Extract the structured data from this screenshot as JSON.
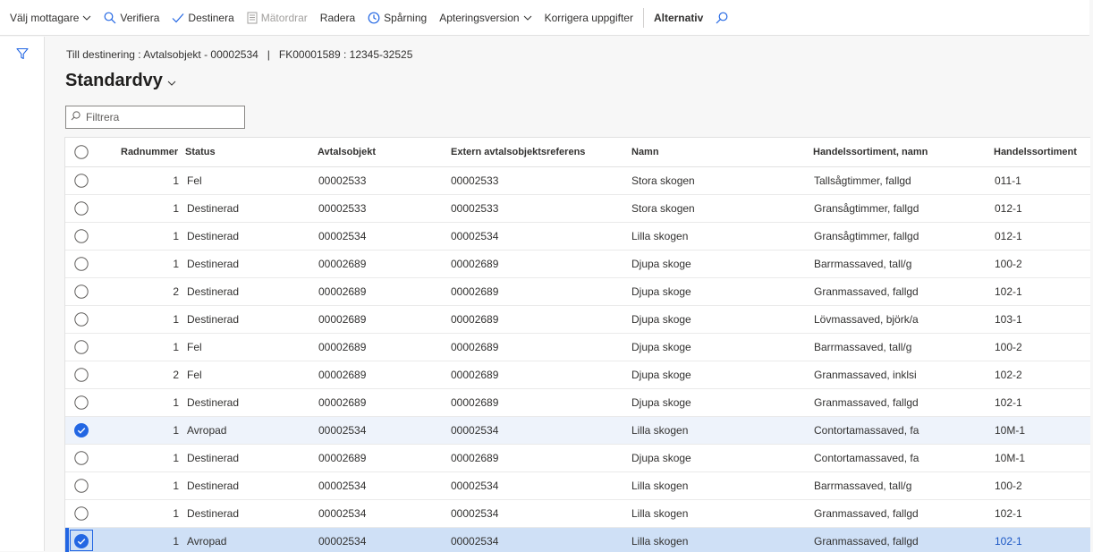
{
  "action_pane": {
    "valj_mottagare": "Välj mottagare",
    "verifiera": "Verifiera",
    "destinera": "Destinera",
    "matordrar": "Mätordrar",
    "radera": "Radera",
    "sparning": "Spårning",
    "apteringsversion": "Apteringsversion",
    "korrigera": "Korrigera uppgifter",
    "alternativ": "Alternativ"
  },
  "breadcrumb": "Till destinering : Avtalsobjekt - 00002534   |   FK00001589 : 12345-32525",
  "view_title": "Standardvy",
  "filter": {
    "placeholder": "Filtrera",
    "value": ""
  },
  "columns": {
    "radnummer": "Radnummer",
    "status": "Status",
    "avtalsobjekt": "Avtalsobjekt",
    "extern": "Extern avtalsobjektsreferens",
    "namn": "Namn",
    "handels_namn": "Handelssortiment, namn",
    "handels": "Handelssortiment"
  },
  "rows": [
    {
      "rad": "1",
      "status": "Fel",
      "avtal": "00002533",
      "extern": "00002533",
      "namn": "Stora skogen",
      "hnamn": "Tallsågtimmer, fallgd",
      "h": "011-1",
      "checked": false,
      "active": false
    },
    {
      "rad": "1",
      "status": "Destinerad",
      "avtal": "00002533",
      "extern": "00002533",
      "namn": "Stora skogen",
      "hnamn": "Gransågtimmer, fallgd",
      "h": "012-1",
      "checked": false,
      "active": false
    },
    {
      "rad": "1",
      "status": "Destinerad",
      "avtal": "00002534",
      "extern": "00002534",
      "namn": "Lilla skogen",
      "hnamn": "Gransågtimmer, fallgd",
      "h": "012-1",
      "checked": false,
      "active": false
    },
    {
      "rad": "1",
      "status": "Destinerad",
      "avtal": "00002689",
      "extern": "00002689",
      "namn": "Djupa skoge",
      "hnamn": "Barrmassaved, tall/g",
      "h": "100-2",
      "checked": false,
      "active": false
    },
    {
      "rad": "2",
      "status": "Destinerad",
      "avtal": "00002689",
      "extern": "00002689",
      "namn": "Djupa skoge",
      "hnamn": "Granmassaved, fallgd",
      "h": "102-1",
      "checked": false,
      "active": false
    },
    {
      "rad": "1",
      "status": "Destinerad",
      "avtal": "00002689",
      "extern": "00002689",
      "namn": "Djupa skoge",
      "hnamn": "Lövmassaved, björk/a",
      "h": "103-1",
      "checked": false,
      "active": false
    },
    {
      "rad": "1",
      "status": "Fel",
      "avtal": "00002689",
      "extern": "00002689",
      "namn": "Djupa skoge",
      "hnamn": "Barrmassaved, tall/g",
      "h": "100-2",
      "checked": false,
      "active": false
    },
    {
      "rad": "2",
      "status": "Fel",
      "avtal": "00002689",
      "extern": "00002689",
      "namn": "Djupa skoge",
      "hnamn": "Granmassaved, inklsi",
      "h": "102-2",
      "checked": false,
      "active": false
    },
    {
      "rad": "1",
      "status": "Destinerad",
      "avtal": "00002689",
      "extern": "00002689",
      "namn": "Djupa skoge",
      "hnamn": "Granmassaved, fallgd",
      "h": "102-1",
      "checked": false,
      "active": false
    },
    {
      "rad": "1",
      "status": "Avropad",
      "avtal": "00002534",
      "extern": "00002534",
      "namn": "Lilla skogen",
      "hnamn": "Contortamassaved, fa",
      "h": "10M-1",
      "checked": true,
      "active": false
    },
    {
      "rad": "1",
      "status": "Destinerad",
      "avtal": "00002689",
      "extern": "00002689",
      "namn": "Djupa skoge",
      "hnamn": "Contortamassaved, fa",
      "h": "10M-1",
      "checked": false,
      "active": false
    },
    {
      "rad": "1",
      "status": "Destinerad",
      "avtal": "00002534",
      "extern": "00002534",
      "namn": "Lilla skogen",
      "hnamn": "Barrmassaved, tall/g",
      "h": "100-2",
      "checked": false,
      "active": false
    },
    {
      "rad": "1",
      "status": "Destinerad",
      "avtal": "00002534",
      "extern": "00002534",
      "namn": "Lilla skogen",
      "hnamn": "Granmassaved, fallgd",
      "h": "102-1",
      "checked": false,
      "active": false
    },
    {
      "rad": "1",
      "status": "Avropad",
      "avtal": "00002534",
      "extern": "00002534",
      "namn": "Lilla skogen",
      "hnamn": "Granmassaved, fallgd",
      "h": "102-1",
      "checked": true,
      "active": true
    }
  ],
  "colors": {
    "accent": "#2266e3",
    "selected_row": "#eef3fb",
    "active_row": "#cfe0f6"
  }
}
